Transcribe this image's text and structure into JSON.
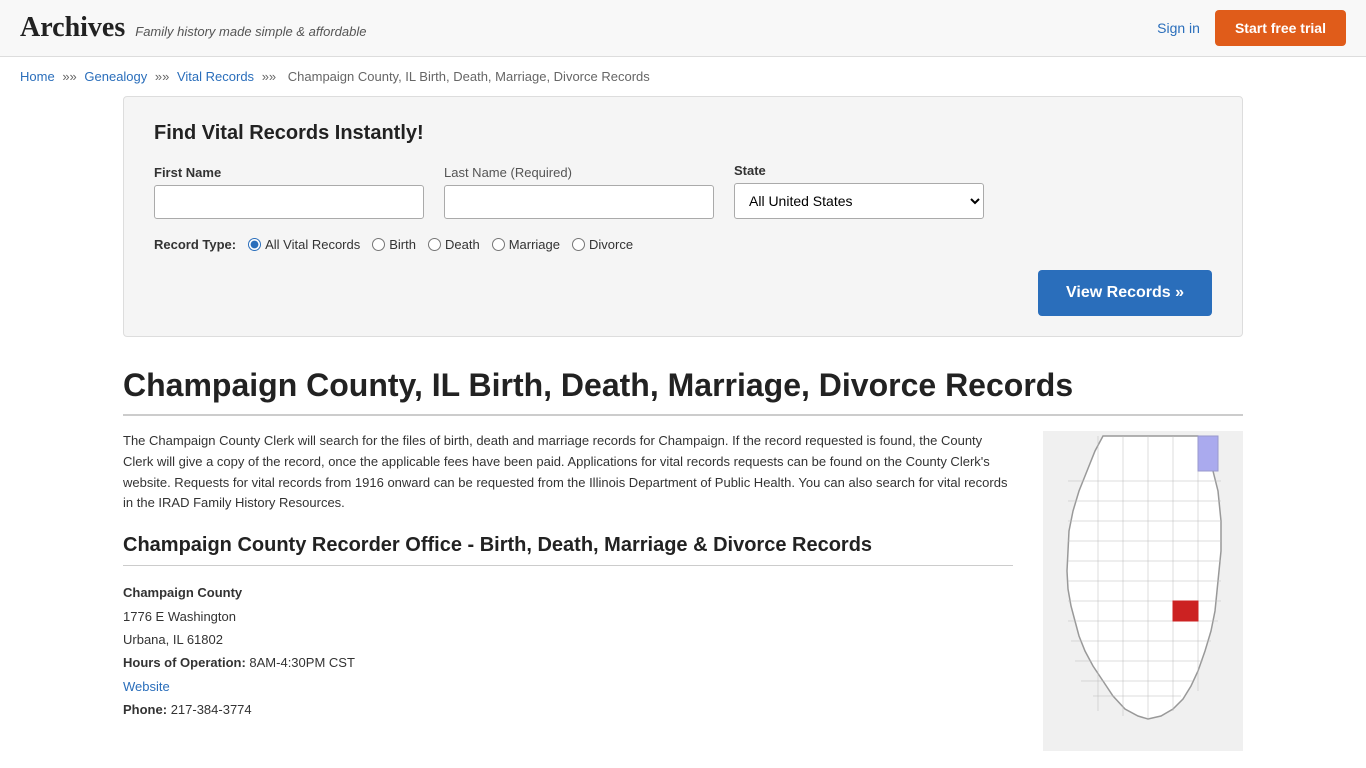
{
  "header": {
    "brand": "Archives",
    "tagline": "Family history made simple & affordable",
    "signin_label": "Sign in",
    "trial_label": "Start free trial"
  },
  "breadcrumb": {
    "home": "Home",
    "genealogy": "Genealogy",
    "vital_records": "Vital Records",
    "current": "Champaign County, IL Birth, Death, Marriage, Divorce Records"
  },
  "search": {
    "title": "Find Vital Records Instantly!",
    "first_name_label": "First Name",
    "last_name_label": "Last Name",
    "last_name_required": "(Required)",
    "state_label": "State",
    "state_default": "All United States",
    "record_type_label": "Record Type:",
    "record_types": [
      "All Vital Records",
      "Birth",
      "Death",
      "Marriage",
      "Divorce"
    ],
    "view_records_btn": "View Records »"
  },
  "page": {
    "title": "Champaign County, IL Birth, Death, Marriage, Divorce Records",
    "description": "The Champaign County Clerk will search for the files of birth, death and marriage records for Champaign. If the record requested is found, the County Clerk will give a copy of the record, once the applicable fees have been paid. Applications for vital records requests can be found on the County Clerk's website. Requests for vital records from 1916 onward can be requested from the Illinois Department of Public Health. You can also search for vital records in the IRAD Family History Resources.",
    "section_heading": "Champaign County Recorder Office - Birth, Death, Marriage & Divorce Records",
    "office": {
      "name": "Champaign County",
      "address1": "1776 E Washington",
      "address2": "Urbana, IL 61802",
      "hours_label": "Hours of Operation:",
      "hours": "8AM-4:30PM CST",
      "website_label": "Website",
      "phone_label": "Phone:",
      "phone": "217-384-3774"
    }
  }
}
